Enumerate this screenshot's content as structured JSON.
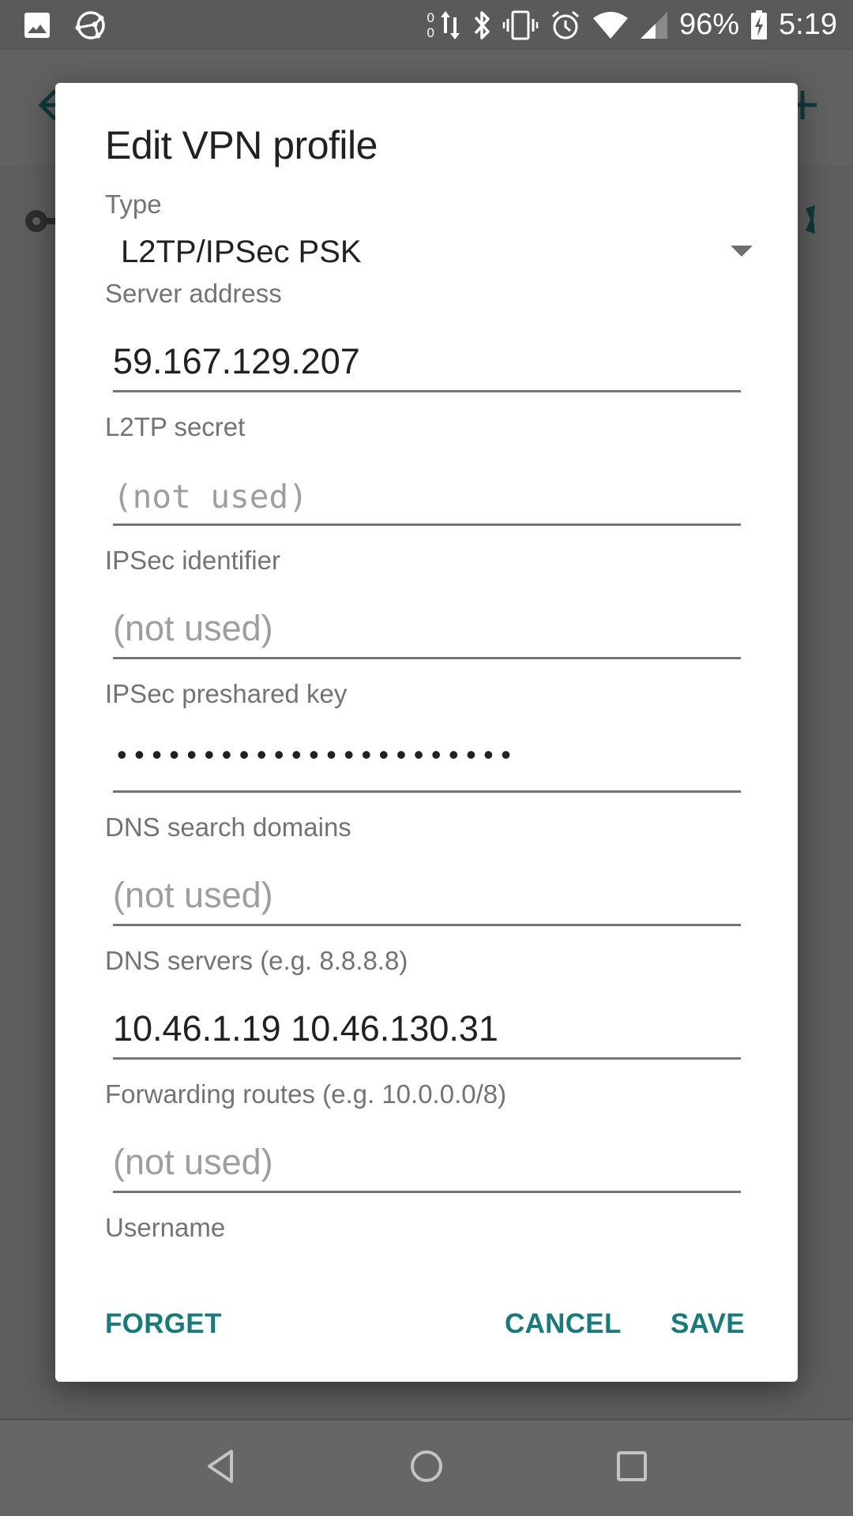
{
  "status_bar": {
    "icons_left": [
      "image-icon",
      "sync-nodes-icon"
    ],
    "data_counter": {
      "up": "0",
      "down": "0"
    },
    "icons_right": [
      "data-arrows-icon",
      "bluetooth-icon",
      "vibrate-icon",
      "alarm-icon",
      "wifi-icon",
      "cell-signal-icon"
    ],
    "battery_percent": "96%",
    "battery_icon": "battery-charging-icon",
    "time": "5:19"
  },
  "background_app": {
    "back_icon": "arrow-back-icon",
    "add_icon": "add-icon",
    "list_item_icon": "vpn-key-icon",
    "settings_icon": "gear-icon"
  },
  "dialog": {
    "title": "Edit VPN profile",
    "type": {
      "label": "Type",
      "selected": "L2TP/IPSec PSK"
    },
    "fields": [
      {
        "label": "Server address",
        "value": "59.167.129.207",
        "placeholder": ""
      },
      {
        "label": "L2TP secret",
        "value": "",
        "placeholder": "(not used)"
      },
      {
        "label": "IPSec identifier",
        "value": "",
        "placeholder": "(not used)"
      },
      {
        "label": "IPSec preshared key",
        "value": "•••••••••••••••••••••••",
        "placeholder": ""
      },
      {
        "label": "DNS search domains",
        "value": "",
        "placeholder": "(not used)"
      },
      {
        "label": "DNS servers (e.g. 8.8.8.8)",
        "value": "10.46.1.19 10.46.130.31",
        "placeholder": ""
      },
      {
        "label": "Forwarding routes (e.g. 10.0.0.0/8)",
        "value": "",
        "placeholder": "(not used)"
      },
      {
        "label": "Username",
        "value": "",
        "placeholder": ""
      }
    ],
    "buttons": {
      "forget": "FORGET",
      "cancel": "CANCEL",
      "save": "SAVE"
    },
    "accent_color": "#167b7b"
  },
  "nav_bar": {
    "back": "nav-back-icon",
    "home": "nav-home-icon",
    "recents": "nav-recents-icon"
  }
}
